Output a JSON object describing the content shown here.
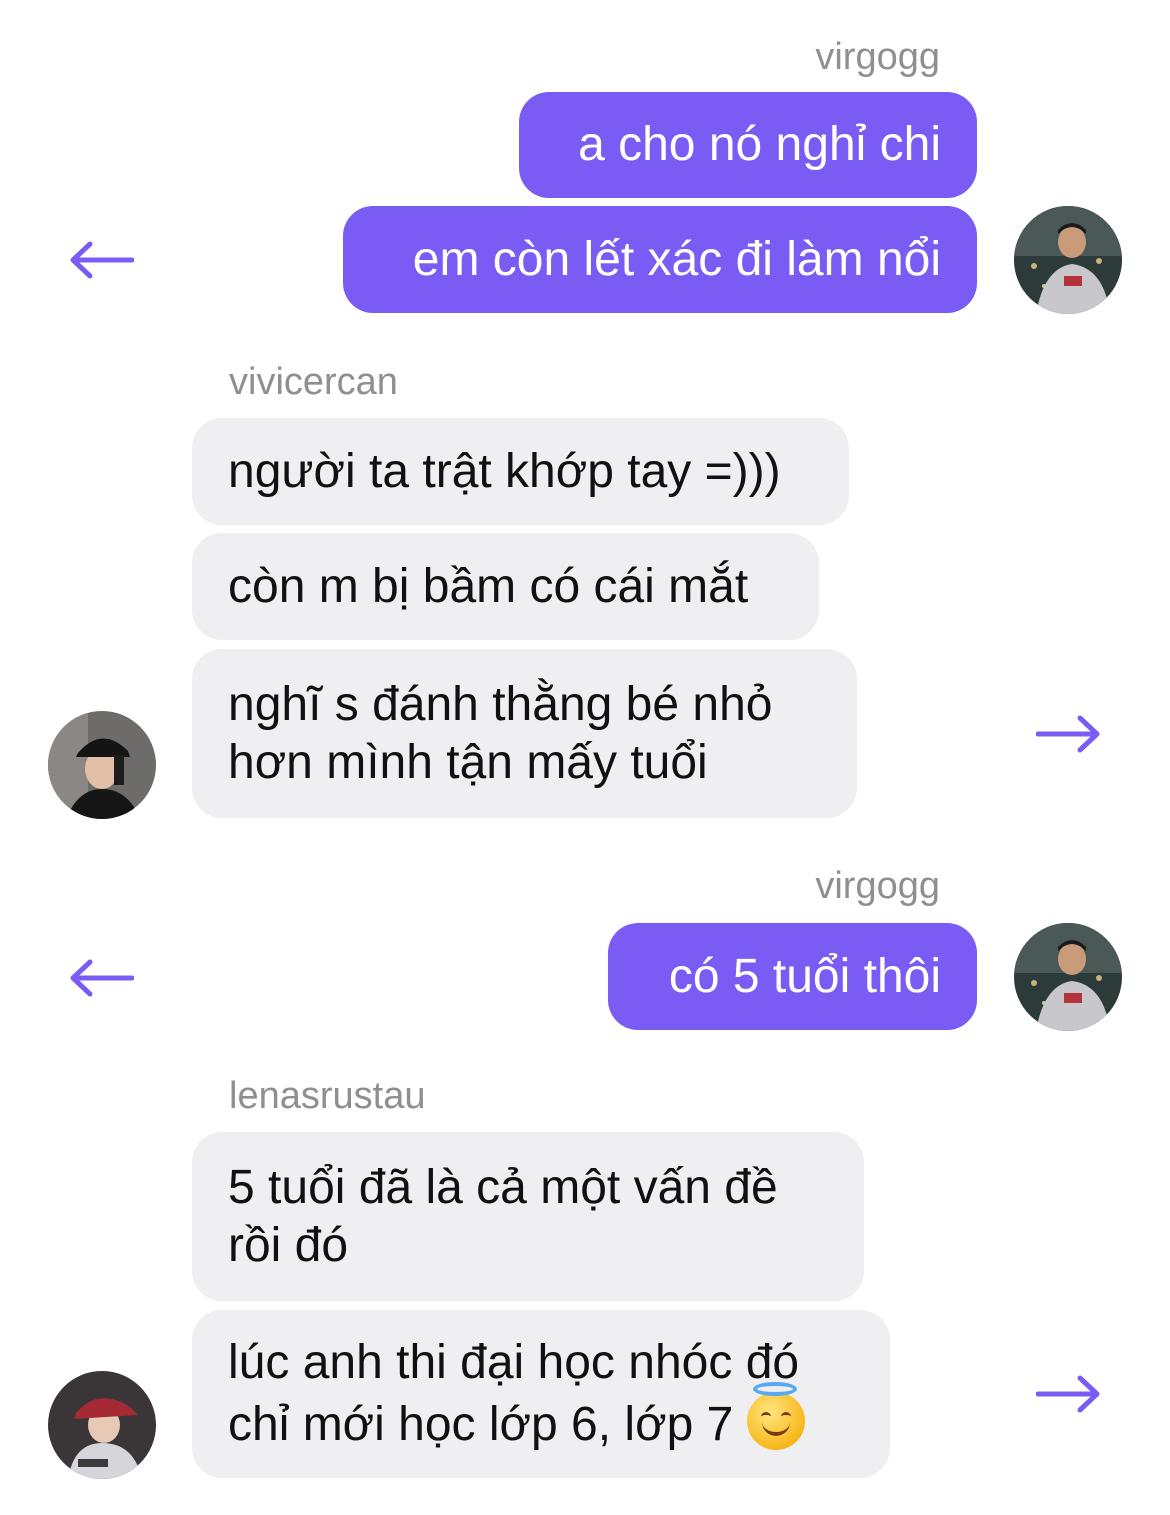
{
  "conversation": {
    "group1": {
      "sender": "virgogg",
      "messages": [
        "a cho nó nghỉ chi",
        "em còn lết xác đi làm nổi"
      ],
      "avatar_icon": "user-avatar-virgogg",
      "action_icon": "arrow-left-icon"
    },
    "group2": {
      "sender": "vivicercan",
      "messages": [
        "người ta trật khớp tay =)))",
        "còn m bị bầm có cái mắt",
        "nghĩ s đánh thằng bé nhỏ\nhơn mình tận mấy tuổi"
      ],
      "avatar_icon": "user-avatar-vivicercan",
      "action_icon": "arrow-right-icon"
    },
    "group3": {
      "sender": "virgogg",
      "messages": [
        "có 5 tuổi thôi"
      ],
      "avatar_icon": "user-avatar-virgogg",
      "action_icon": "arrow-left-icon"
    },
    "group4": {
      "sender": "lenasrustau",
      "messages": [
        "5 tuổi đã là cả một vấn đề\nrồi đó",
        "lúc anh thi đại học nhóc đó\nchỉ mới học lớp 6, lớp 7"
      ],
      "emoji": "smiling-face-with-halo-icon",
      "avatar_icon": "user-avatar-lenasrustau",
      "action_icon": "arrow-right-icon"
    }
  },
  "colors": {
    "outgoing_bubble": "#7a5cf5",
    "incoming_bubble": "#efeff2",
    "sender_name": "#8e8e93",
    "arrow": "#7a5cf5"
  }
}
